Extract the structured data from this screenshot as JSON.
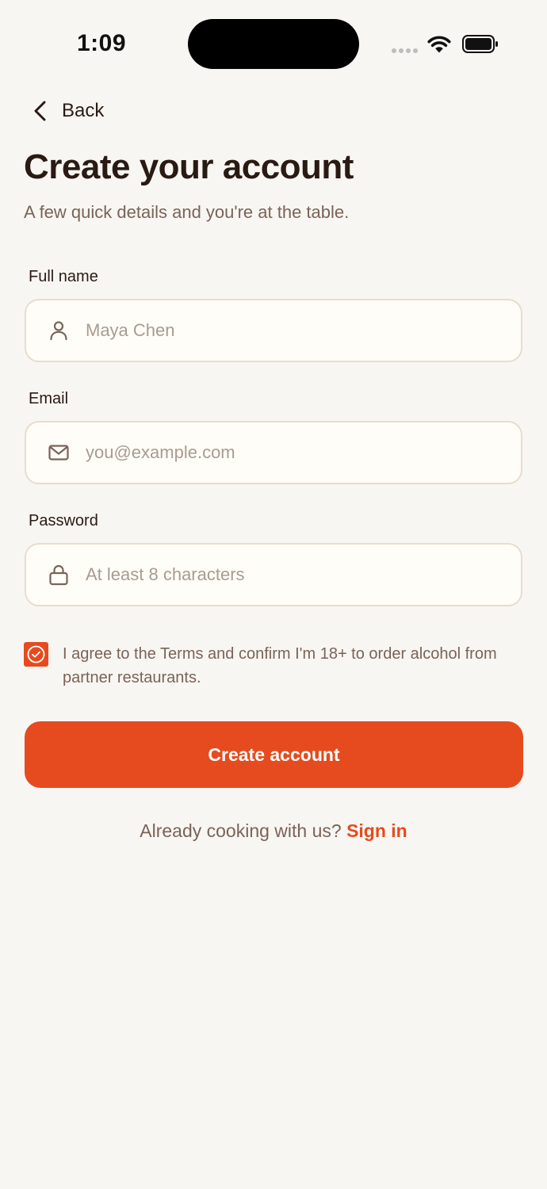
{
  "status_bar": {
    "time": "1:09"
  },
  "nav": {
    "back_label": "Back"
  },
  "header": {
    "title": "Create your account",
    "subtitle": "A few quick details and you're at the table."
  },
  "form": {
    "full_name": {
      "label": "Full name",
      "placeholder": "Maya Chen",
      "value": "",
      "icon": "person-icon"
    },
    "email": {
      "label": "Email",
      "placeholder": "you@example.com",
      "value": "",
      "icon": "mail-icon"
    },
    "password": {
      "label": "Password",
      "placeholder": "At least 8 characters",
      "value": "",
      "icon": "lock-icon"
    },
    "terms": {
      "checked": true,
      "text": "I agree to the Terms and confirm I'm 18+ to order alcohol from partner restaurants."
    },
    "submit_label": "Create account"
  },
  "footer": {
    "prompt": "Already cooking with us?",
    "link_label": "Sign in"
  },
  "colors": {
    "accent": "#e54b1f",
    "background": "#f8f6f2",
    "field_background": "#fffdf8",
    "field_border": "#e7ddcd",
    "text_primary": "#2a1a14",
    "text_secondary": "#7a6358",
    "placeholder": "#a89b91"
  }
}
